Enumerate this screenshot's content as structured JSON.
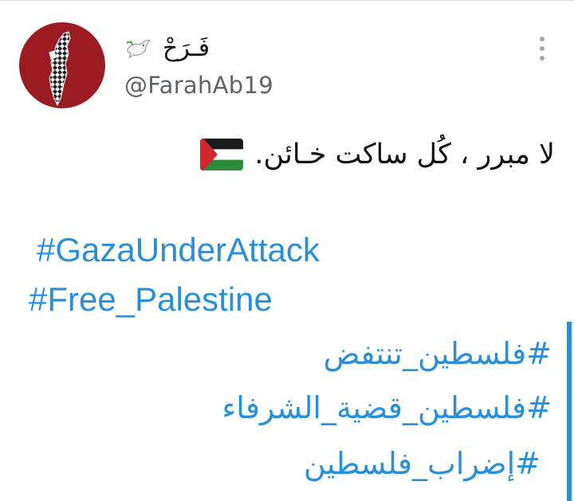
{
  "user": {
    "display_name": "فَـرَحْ",
    "handle": "@FarahAb19",
    "avatar_icon": "palestine-map-keffiyeh-icon",
    "name_emoji_icon": "dove-icon"
  },
  "tweet": {
    "text": "لا مبرر ، كُل ساكت خـائن.",
    "flag_icon": "palestine-flag-icon",
    "hashtags": [
      "#GazaUnderAttack",
      "#Free_Palestine",
      "#فلسطين_تنتفض",
      "#فلسطين_قضية_الشرفاء",
      "#إضراب_فلسطين"
    ]
  },
  "menu": {
    "icon": "more-vertical-icon"
  },
  "colors": {
    "hashtag": "#2a8fd6",
    "avatar_bg": "#9a1c22",
    "handle": "#5f6368",
    "text": "#111111",
    "menu_dots": "#a7a7a7"
  }
}
